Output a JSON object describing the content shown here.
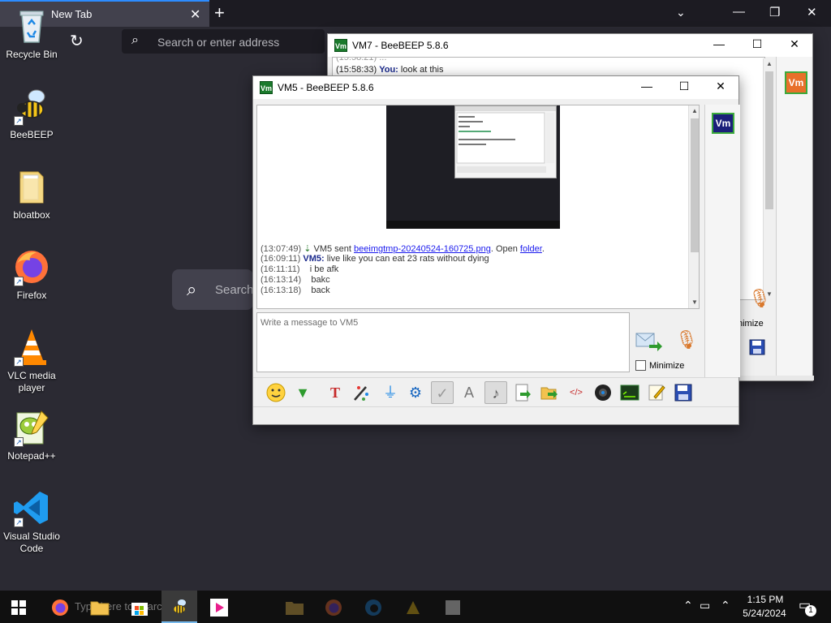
{
  "browser": {
    "tab_title": "New Tab",
    "tab_close_glyph": "✕",
    "new_tab_glyph": "+",
    "url_placeholder": "Search or enter address",
    "page_search_text": "Search"
  },
  "desktop": {
    "icons": [
      {
        "label": "Recycle Bin",
        "icon": "recycle-bin-icon"
      },
      {
        "label": "BeeBEEP",
        "icon": "bee-icon"
      },
      {
        "label": "bloatbox",
        "icon": "folder-icon"
      },
      {
        "label": "Firefox",
        "icon": "firefox-icon"
      },
      {
        "label": "VLC media player",
        "icon": "vlc-cone-icon"
      },
      {
        "label": "Notepad++",
        "icon": "notepad-plus-plus-icon"
      },
      {
        "label": "Visual Studio Code",
        "icon": "vscode-icon"
      }
    ]
  },
  "vm7": {
    "title": "VM7 - BeeBEEP 5.8.6",
    "badge": "Vm",
    "lines": [
      {
        "time": "(15:58:33)",
        "who": "You:",
        "text": " look at this"
      }
    ],
    "minimize_label": "nimize"
  },
  "vm5": {
    "title": "VM5 - BeeBEEP 5.8.6",
    "badge": "Vm",
    "messages": [
      {
        "time": "(13:07:49)",
        "pre": " VM5 sent ",
        "link": "beeimgtmp-20240524-160725.png",
        "mid": ". Open ",
        "link2": "folder",
        "post": "."
      },
      {
        "time": "(16:09:11)",
        "who": "VM5:",
        "text": " live like you can eat 23 rats without dying"
      },
      {
        "time": "(16:11:11)",
        "text": "   i be afk"
      },
      {
        "time": "(16:13:14)",
        "text": "   bakc"
      },
      {
        "time": "(16:13:18)",
        "text": "   back"
      }
    ],
    "compose_placeholder": "Write a message to VM5",
    "minimize_label": "Minimize"
  },
  "taskbar": {
    "search_text": "Type here to search",
    "time": "1:15 PM",
    "date": "5/24/2024",
    "notification_count": "1"
  }
}
